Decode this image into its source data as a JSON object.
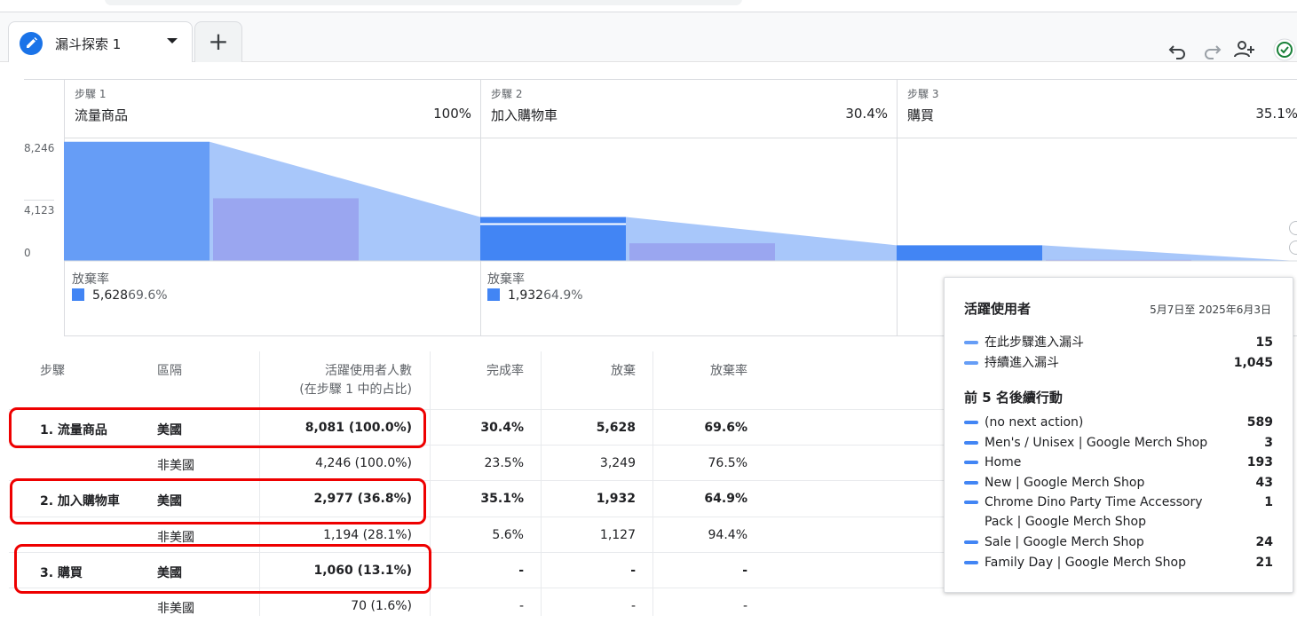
{
  "tab": {
    "title": "漏斗探索 1",
    "add_label": "+"
  },
  "funnel": {
    "y_ticks": [
      "8,246",
      "4,123",
      "0"
    ],
    "steps": [
      {
        "label": "步驟 1",
        "name": "流量商品",
        "pct": "100%"
      },
      {
        "label": "步驟 2",
        "name": "加入購物車",
        "pct": "30.4%"
      },
      {
        "label": "步驟 3",
        "name": "購買",
        "pct": "35.1%"
      }
    ],
    "abandon": [
      {
        "title": "放棄率",
        "value": "5,628",
        "rate": "69.6%"
      },
      {
        "title": "放棄率",
        "value": "1,932",
        "rate": "64.9%"
      }
    ]
  },
  "chart_data": {
    "type": "bar",
    "ylim": [
      0,
      8246
    ],
    "y_ticks": [
      0,
      4123,
      8246
    ],
    "categories": [
      "流量商品",
      "加入購物車",
      "購買"
    ],
    "series": [
      {
        "name": "美國",
        "values": [
          8081,
          2977,
          1060
        ]
      },
      {
        "name": "非美國",
        "values": [
          4246,
          1194,
          70
        ]
      }
    ],
    "colors": {
      "primary": "#4285f4",
      "secondary": "#9aa6f0",
      "flow": "#a8c7fa",
      "step1_bar": "#669df6"
    }
  },
  "table": {
    "headers": {
      "step": "步驟",
      "segment": "區隔",
      "users_line1": "活躍使用者人數",
      "users_line2": "(在步驟 1 中的占比)",
      "completion": "完成率",
      "abandon": "放棄",
      "abandon_rate": "放棄率"
    },
    "rows": [
      {
        "step": "1. 流量商品",
        "segment": "美國",
        "users": "8,081 (100.0%)",
        "completion": "30.4%",
        "abandon": "5,628",
        "abandon_rate": "69.6%",
        "bold": true
      },
      {
        "step": "",
        "segment": "非美國",
        "users": "4,246 (100.0%)",
        "completion": "23.5%",
        "abandon": "3,249",
        "abandon_rate": "76.5%",
        "bold": false
      },
      {
        "step": "2. 加入購物車",
        "segment": "美國",
        "users": "2,977 (36.8%)",
        "completion": "35.1%",
        "abandon": "1,932",
        "abandon_rate": "64.9%",
        "bold": true
      },
      {
        "step": "",
        "segment": "非美國",
        "users": "1,194 (28.1%)",
        "completion": "5.6%",
        "abandon": "1,127",
        "abandon_rate": "94.4%",
        "bold": false
      },
      {
        "step": "3. 購買",
        "segment": "美國",
        "users": "1,060 (13.1%)",
        "completion": "-",
        "abandon": "-",
        "abandon_rate": "-",
        "bold": true
      },
      {
        "step": "",
        "segment": "非美國",
        "users": "70 (1.6%)",
        "completion": "-",
        "abandon": "-",
        "abandon_rate": "-",
        "bold": false
      }
    ]
  },
  "tooltip": {
    "title": "活躍使用者",
    "date": "5月7日至 2025年6月3日",
    "entries": [
      {
        "label": "在此步驟進入漏斗",
        "value": "15"
      },
      {
        "label": "持續進入漏斗",
        "value": "1,045"
      }
    ],
    "next_title": "前 5 名後續行動",
    "next": [
      {
        "label": "(no next action)",
        "value": "589"
      },
      {
        "label": "Men's / Unisex | Google Merch Shop",
        "value": "3"
      },
      {
        "label": "Home",
        "value": "193"
      },
      {
        "label": "New | Google Merch Shop",
        "value": "43"
      },
      {
        "label": "Chrome Dino Party Time Accessory Pack | Google Merch Shop",
        "value": "1"
      },
      {
        "label": "Sale | Google Merch Shop",
        "value": "24"
      },
      {
        "label": "Family Day | Google Merch Shop",
        "value": "21"
      }
    ]
  }
}
